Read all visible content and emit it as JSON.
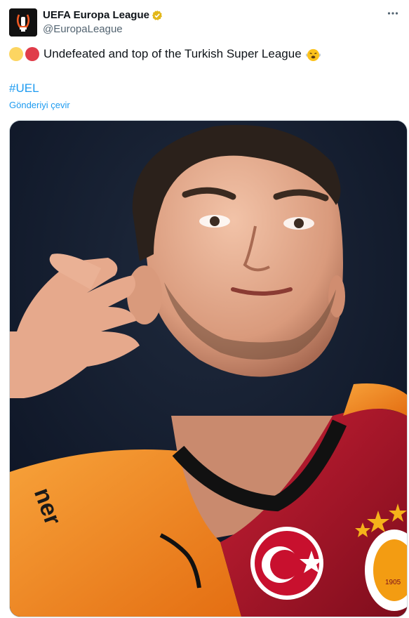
{
  "account": {
    "display_name": "UEFA Europa League",
    "handle": "@EuropaLeague"
  },
  "tweet": {
    "text": "Undefeated and top of the Turkish Super League",
    "circle_colors": [
      "#fcd561",
      "#e03c49"
    ],
    "hashtag": "#UEL",
    "translate_label": "Gönderiyi çevir"
  },
  "media": {
    "jersey_text": "ner",
    "badge_number": "1905"
  },
  "icons": {
    "verified": "verified-badge-icon",
    "more": "more-options-icon",
    "emoji": "steam-face-emoji"
  },
  "colors": {
    "link": "#1d9bf0",
    "secondary_text": "#536471",
    "jersey_orange": "#f28a1c",
    "jersey_red": "#a6142a"
  }
}
